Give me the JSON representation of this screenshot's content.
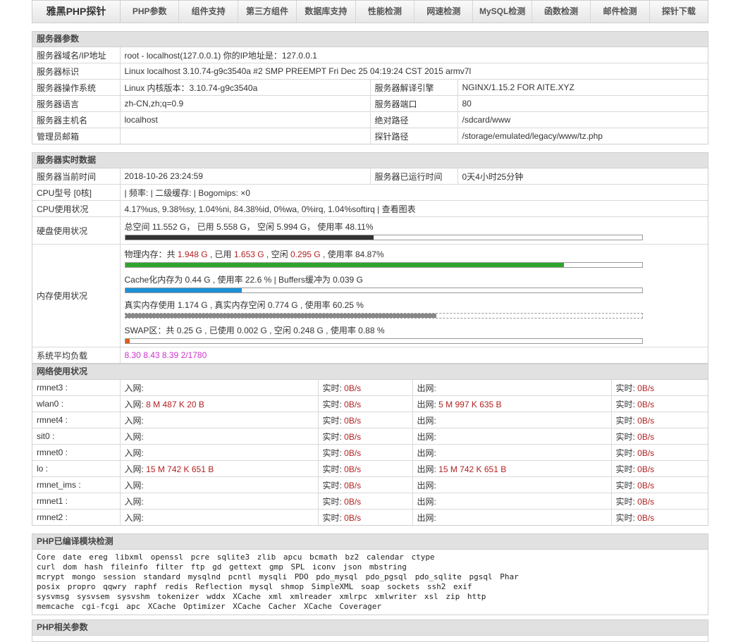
{
  "nav": {
    "brand": "雅黑PHP探针",
    "items": [
      "PHP参数",
      "组件支持",
      "第三方组件",
      "数据库支持",
      "性能检测",
      "网速检测",
      "MySQL检测",
      "函数检测",
      "邮件检测",
      "探针下载"
    ]
  },
  "server_params": {
    "title": "服务器参数",
    "domain_ip": {
      "label": "服务器域名/IP地址",
      "value": "root - localhost(127.0.0.1)  你的IP地址是：127.0.0.1"
    },
    "identity": {
      "label": "服务器标识",
      "value": "Linux localhost 3.10.74-g9c3540a #2 SMP PREEMPT Fri Dec 25 04:19:24 CST 2015 armv7l"
    },
    "os": {
      "label": "服务器操作系统",
      "value": "Linux  内核版本：3.10.74-g9c3540a"
    },
    "engine": {
      "label": "服务器解译引擎",
      "value": "NGINX/1.15.2 FOR AITE.XYZ"
    },
    "lang": {
      "label": "服务器语言",
      "value": "zh-CN,zh;q=0.9"
    },
    "port": {
      "label": "服务器端口",
      "value": "80"
    },
    "host": {
      "label": "服务器主机名",
      "value": "localhost"
    },
    "abs_path": {
      "label": "绝对路径",
      "value": "/sdcard/www"
    },
    "admin": {
      "label": "管理员邮箱",
      "value": ""
    },
    "probe_path": {
      "label": "探针路径",
      "value": "/storage/emulated/legacy/www/tz.php"
    }
  },
  "realtime": {
    "title": "服务器实时数据",
    "time": {
      "label": "服务器当前时间",
      "value": "2018-10-26 23:24:59"
    },
    "uptime": {
      "label": "服务器已运行时间",
      "value": "0天4小时25分钟"
    },
    "cpu_model": {
      "label": "CPU型号 [0核]",
      "value": "| 频率: | 二级缓存: | Bogomips: ×0"
    },
    "cpu_usage": {
      "label": "CPU使用状况",
      "value": "4.17%us, 9.38%sy, 1.04%ni, 84.38%id, 0%wa, 0%irq, 1.04%softirq | 查看图表"
    },
    "disk": {
      "label": "硬盘使用状况",
      "value": "总空间 11.552 G， 已用 5.558 G， 空闲 5.994 G， 使用率 48.11%",
      "percent": 48.11,
      "color": "#333333"
    },
    "memory": {
      "label": "内存使用状况",
      "physical": {
        "p1": "物理内存：共 ",
        "total": "1.948 G",
        "p2": " , 已用 ",
        "used": "1.653 G",
        "p3": " , 空闲 ",
        "free": "0.295 G",
        "p4": " , 使用率 84.87%",
        "percent": 84.87,
        "color": "#2da52d"
      },
      "cache": {
        "text": "Cache化内存为 0.44 G , 使用率 22.6 % | Buffers缓冲为 0.039 G",
        "percent": 22.6,
        "color": "#1e90d6"
      },
      "real": {
        "text": "真实内存使用 1.174 G , 真实内存空闲 0.774 G , 使用率 60.25 %",
        "percent": 60.25,
        "color": "#888888"
      },
      "swap": {
        "text": "SWAP区：共 0.25 G , 已使用 0.002 G , 空闲 0.248 G , 使用率 0.88 %",
        "percent": 0.88,
        "color": "#e05a1a"
      }
    },
    "load": {
      "label": "系统平均负载",
      "value": "8.30 8.43 8.39 2/1780"
    }
  },
  "network": {
    "title": "网络使用状况",
    "in_label": "入网: ",
    "out_label": "出网: ",
    "rate_label": "实时: ",
    "rows": [
      {
        "name": "rmnet3 :",
        "in": "",
        "in_rate": "0B/s",
        "out": "",
        "out_rate": "0B/s"
      },
      {
        "name": "wlan0 :",
        "in": "8 M 487 K 20 B",
        "in_rate": "0B/s",
        "out": "5 M 997 K 635 B",
        "out_rate": "0B/s"
      },
      {
        "name": "rmnet4 :",
        "in": "",
        "in_rate": "0B/s",
        "out": "",
        "out_rate": "0B/s"
      },
      {
        "name": "sit0 :",
        "in": "",
        "in_rate": "0B/s",
        "out": "",
        "out_rate": "0B/s"
      },
      {
        "name": "rmnet0 :",
        "in": "",
        "in_rate": "0B/s",
        "out": "",
        "out_rate": "0B/s"
      },
      {
        "name": "lo :",
        "in": "15 M 742 K 651 B",
        "in_rate": "0B/s",
        "out": "15 M 742 K 651 B",
        "out_rate": "0B/s"
      },
      {
        "name": "rmnet_ims :",
        "in": "",
        "in_rate": "0B/s",
        "out": "",
        "out_rate": "0B/s"
      },
      {
        "name": "rmnet1 :",
        "in": "",
        "in_rate": "0B/s",
        "out": "",
        "out_rate": "0B/s"
      },
      {
        "name": "rmnet2 :",
        "in": "",
        "in_rate": "0B/s",
        "out": "",
        "out_rate": "0B/s"
      }
    ]
  },
  "modules": {
    "title": "PHP已编译模块检测",
    "lines": [
      "Core  date  ereg  libxml  openssl  pcre  sqlite3  zlib  apcu  bcmath  bz2  calendar  ctype",
      "curl  dom  hash  fileinfo  filter  ftp  gd  gettext  gmp  SPL  iconv  json  mbstring",
      "mcrypt  mongo  session  standard  mysqlnd  pcntl  mysqli  PDO  pdo_mysql  pdo_pgsql  pdo_sqlite  pgsql  Phar",
      "posix  propro  qqwry  raphf  redis  Reflection  mysql  shmop  SimpleXML  soap  sockets  ssh2  exif",
      "sysvmsg  sysvsem  sysvshm  tokenizer  wddx  XCache  xml  xmlreader  xmlrpc  xmlwriter  xsl  zip  http",
      "memcache  cgi-fcgi  apc  XCache Optimizer  XCache Cacher  XCache Coverager"
    ]
  },
  "php_params": {
    "title": "PHP相关参数"
  }
}
